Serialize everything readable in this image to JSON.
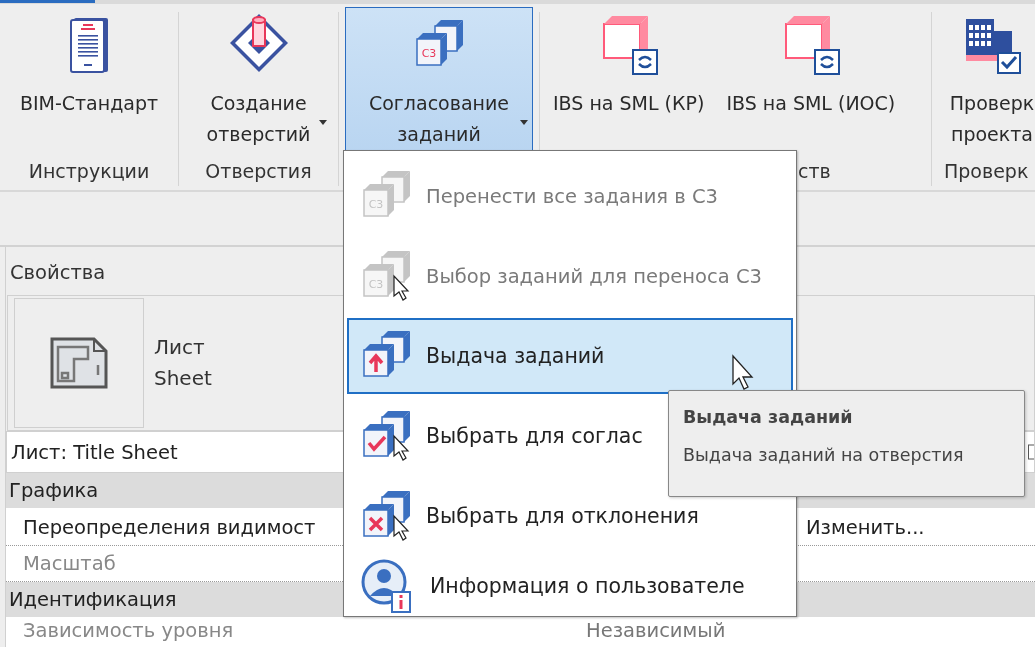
{
  "ribbon": {
    "groups": [
      {
        "label": "Инструкции",
        "buttons": [
          {
            "lines": [
              "BIM-Стандарт"
            ],
            "dropdown": false,
            "selected": false
          }
        ]
      },
      {
        "label": "Отверстия",
        "buttons": [
          {
            "lines": [
              "Создание",
              "отверстий"
            ],
            "dropdown": true,
            "selected": false
          }
        ]
      },
      {
        "buttons": [
          {
            "lines": [
              "Согласование",
              "заданий"
            ],
            "dropdown": true,
            "selected": true,
            "icon_label": "С3"
          }
        ]
      },
      {
        "label": "ств",
        "buttons": [
          {
            "lines": [
              "IBS на SML (КР)"
            ],
            "dropdown": false,
            "selected": false
          },
          {
            "lines": [
              "IBS на SML (ИОС)"
            ],
            "dropdown": false,
            "selected": false
          }
        ]
      },
      {
        "label": "Проверк",
        "buttons": [
          {
            "lines": [
              "Проверк",
              "проекта"
            ],
            "dropdown": false,
            "selected": false
          }
        ]
      }
    ]
  },
  "properties": {
    "title": "Свойства",
    "type_lines": [
      "Лист",
      "Sheet"
    ],
    "selector": "Лист: Title Sheet",
    "rows": [
      {
        "kind": "category",
        "label": "Графика"
      },
      {
        "kind": "param",
        "label": "Переопределения видимост",
        "value": "Изменить...",
        "disabled": false
      },
      {
        "kind": "param",
        "label": "Масштаб",
        "disabled": true
      },
      {
        "kind": "category",
        "label": "Идентификация"
      },
      {
        "kind": "param",
        "label": "Зависимость уровня",
        "value": "Независимый",
        "disabled": true
      }
    ]
  },
  "menu": {
    "items": [
      {
        "label": "Перенести все задания в С3",
        "disabled": true,
        "selected": false,
        "icon_label": "С3"
      },
      {
        "label": "Выбор заданий для переноса С3",
        "disabled": true,
        "selected": false,
        "icon_label": "С3"
      },
      {
        "label": "Выдача заданий",
        "disabled": false,
        "selected": true
      },
      {
        "label": "Выбрать для соглас",
        "disabled": false,
        "selected": false
      },
      {
        "label": "Выбрать для отклонения",
        "disabled": false,
        "selected": false
      },
      {
        "label": "Информация о пользователе",
        "disabled": false,
        "selected": false
      }
    ]
  },
  "tooltip": {
    "title": "Выдача заданий",
    "description": "Выдача заданий на отверстия"
  }
}
